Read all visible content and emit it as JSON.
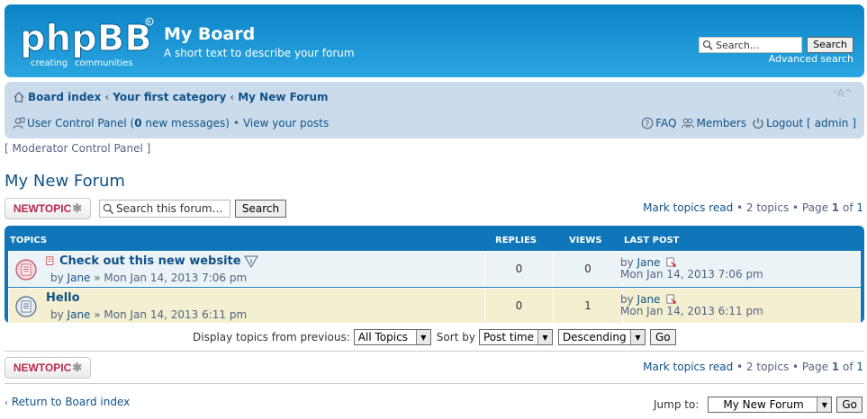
{
  "header": {
    "site_title": "My Board",
    "site_description": "A short text to describe your forum",
    "logo_text": "phpBB",
    "logo_tagline": "creating communities",
    "search_placeholder": "Search…",
    "search_button": "Search",
    "advanced_search": "Advanced search"
  },
  "breadcrumb": [
    "Board index",
    "Your first category",
    "My New Forum"
  ],
  "font_toggle": "ᵛA^",
  "usernav": {
    "ucp_label": "User Control Panel (",
    "new_count": "0",
    "new_messages_label": " new messages)",
    "bullet": "•",
    "view_posts": "View your posts",
    "faq": "FAQ",
    "members": "Members",
    "logout_label": "Logout [",
    "logout_user": "admin",
    "logout_close": "]"
  },
  "mcp": "[ Moderator Control Panel ]",
  "forum_title": "My New Forum",
  "actions": {
    "new_topic": "NEWTOPIC",
    "new_topic_star": "✱",
    "forum_search_placeholder": "Search this forum…",
    "forum_search_button": "Search",
    "mark_read": "Mark topics read",
    "pagination_info": " • 2 topics • Page ",
    "page_current": "1",
    "page_of": " of ",
    "page_total": "1"
  },
  "table": {
    "headers": {
      "topics": "TOPICS",
      "replies": "REPLIES",
      "views": "VIEWS",
      "last_post": "LAST POST"
    },
    "rows": [
      {
        "title": "Check out this new website",
        "by": "by ",
        "author": "Jane",
        "date": " » Mon Jan 14, 2013 7:06 pm",
        "replies": "0",
        "views": "0",
        "last_by": "by ",
        "last_author": "Jane",
        "last_date": "Mon Jan 14, 2013 7:06 pm",
        "unread": true
      },
      {
        "title": "Hello",
        "by": "by ",
        "author": "Jane",
        "date": " » Mon Jan 14, 2013 6:11 pm",
        "replies": "0",
        "views": "1",
        "last_by": "by ",
        "last_author": "Jane",
        "last_date": "Mon Jan 14, 2013 6:11 pm",
        "unread": false
      }
    ]
  },
  "display": {
    "label": "Display topics from previous:",
    "days_value": "All Topics",
    "sort_label": "Sort by",
    "sort_value": "Post time",
    "order_value": "Descending",
    "go": "Go"
  },
  "footer_nav": {
    "return": "Return to Board index",
    "jump_label": "Jump to:",
    "jump_value": "My New Forum",
    "go": "Go"
  },
  "colors": {
    "header_blue": "#0b84c6",
    "nav_bg": "#cadceb",
    "table_blue": "#0f76b9",
    "row1": "#ecf3f7",
    "row2": "#f3efd0",
    "link": "#105289",
    "newtopic_red": "#bc2a4d"
  }
}
